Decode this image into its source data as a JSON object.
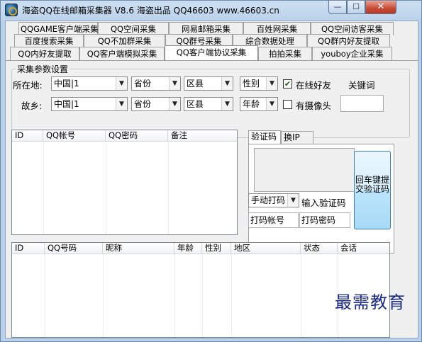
{
  "window": {
    "title": "海盗QQ在线邮箱采集器  V8.6  海盗出品  QQ46603 www.46603.cn",
    "min_label": "—",
    "max_label": "☐",
    "close_label": "✕"
  },
  "tabs": {
    "row1": [
      "QQGAME客户端采集",
      "QQ空间采集",
      "网易邮箱采集",
      "百姓网采集",
      "QQ空间访客采集"
    ],
    "row2": [
      "百度搜索采集",
      "QQ不加群采集",
      "QQ群号采集",
      "综合数据处理",
      "QQ群内好友提取"
    ],
    "row3": [
      "QQ内好友提取",
      "QQ客户端模拟采集",
      "QQ客户端协议采集",
      "拍拍采集",
      "youboy企业采集"
    ],
    "selected": "QQ客户端协议采集"
  },
  "params": {
    "group_label": "采集参数设置",
    "location_label": "所在地:",
    "hometown_label": "故乡:",
    "location": {
      "country": "中国|1",
      "province": "省份",
      "district": "区县",
      "gender": "性别"
    },
    "hometown": {
      "country": "中国|1",
      "province": "省份",
      "district": "区县",
      "age": "年龄"
    },
    "online_friends_label": "在线好友",
    "online_friends_checked": true,
    "has_camera_label": "有摄像头",
    "has_camera_checked": false,
    "keyword_label": "关键词",
    "keyword_value": ""
  },
  "accounts_list": {
    "columns": [
      "ID",
      "QQ帐号",
      "QQ密码",
      "备注"
    ]
  },
  "verify": {
    "tabs": [
      "验证码",
      "换IP"
    ],
    "selected_tab": "验证码",
    "submit_label": "回车键提交验证码",
    "mode_select": "手动打码",
    "input_label": "输入验证码",
    "code_account_label": "打码帐号",
    "code_password_label": "打码密码"
  },
  "results_list": {
    "columns": [
      "ID",
      "QQ号码",
      "昵称",
      "年龄",
      "性别",
      "地区",
      "状态",
      "会话"
    ]
  },
  "watermark": "最需教育"
}
